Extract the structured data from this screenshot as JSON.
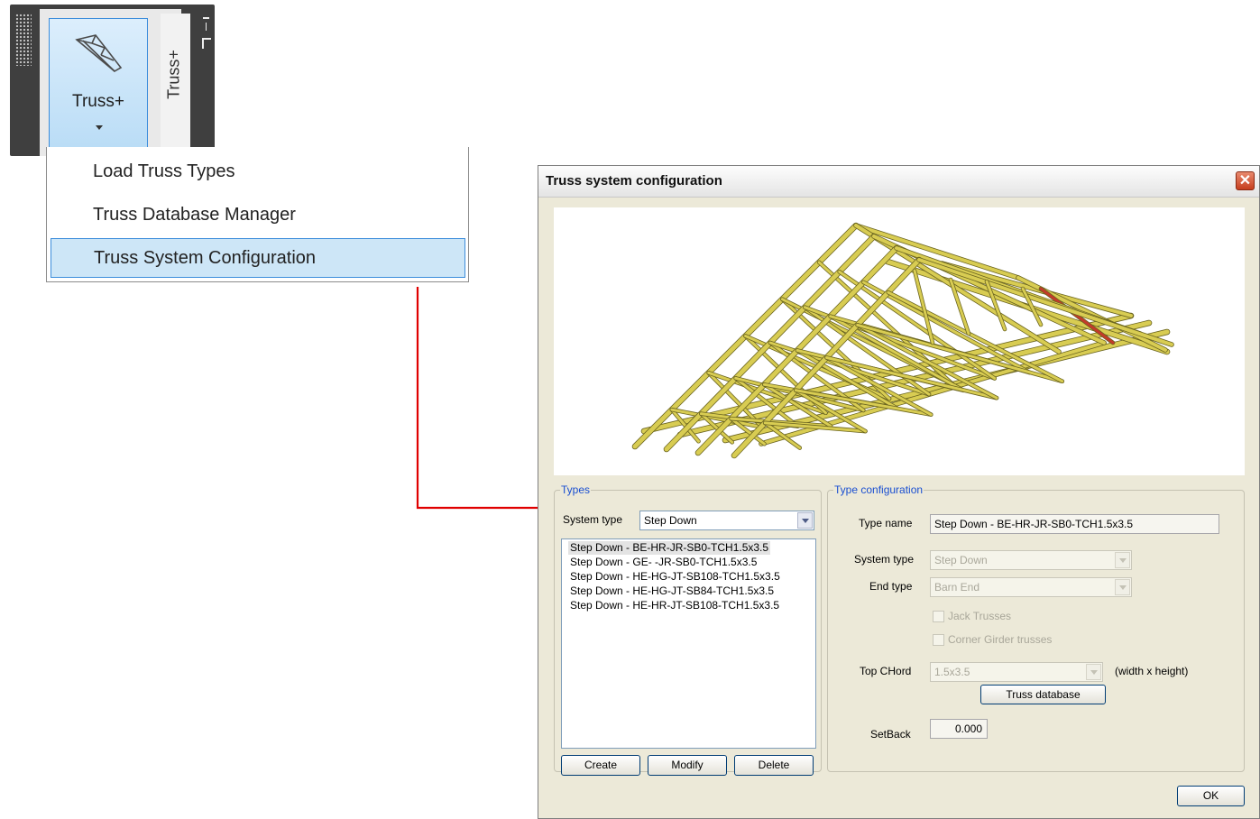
{
  "ribbon": {
    "button_label": "Truss+",
    "tab_label": "Truss+",
    "button_icon": "truss-icon",
    "grip_icon": "grip-icon",
    "pin_icon": "pin-icon",
    "expand_icon": "dropdown-arrow-icon"
  },
  "menu": {
    "items": [
      {
        "label": "Load Truss Types",
        "selected": false
      },
      {
        "label": "Truss Database Manager",
        "selected": false
      },
      {
        "label": "Truss System Configuration",
        "selected": true
      }
    ]
  },
  "connector": {
    "color": "#e00000"
  },
  "dialog": {
    "title": "Truss system configuration",
    "close_icon": "close-icon",
    "types": {
      "legend": "Types",
      "system_type_label": "System type",
      "system_type_value": "Step Down",
      "list": [
        "Step Down - BE-HR-JR-SB0-TCH1.5x3.5",
        "Step Down - GE-  -JR-SB0-TCH1.5x3.5",
        "Step Down - HE-HG-JT-SB108-TCH1.5x3.5",
        "Step Down - HE-HG-JT-SB84-TCH1.5x3.5",
        "Step Down - HE-HR-JT-SB108-TCH1.5x3.5"
      ],
      "create_label": "Create",
      "modify_label": "Modify",
      "delete_label": "Delete"
    },
    "config": {
      "legend": "Type configuration",
      "type_name_label": "Type name",
      "type_name_value": "Step Down - BE-HR-JR-SB0-TCH1.5x3.5",
      "system_type_label": "System type",
      "system_type_value": "Step Down",
      "end_type_label": "End type",
      "end_type_value": "Barn End",
      "jack_trusses_label": "Jack Trusses",
      "corner_girder_label": "Corner Girder trusses",
      "top_chord_label": "Top CHord",
      "top_chord_value": "1.5x3.5",
      "top_chord_unit": "(width x height)",
      "truss_database_label": "Truss database",
      "setback_label": "SetBack",
      "setback_value": "0.000"
    },
    "ok_label": "OK",
    "colors": {
      "truss_wood": "#d8cc52",
      "truss_edge": "#6b6520",
      "truss_end": "#c23b2a"
    }
  }
}
